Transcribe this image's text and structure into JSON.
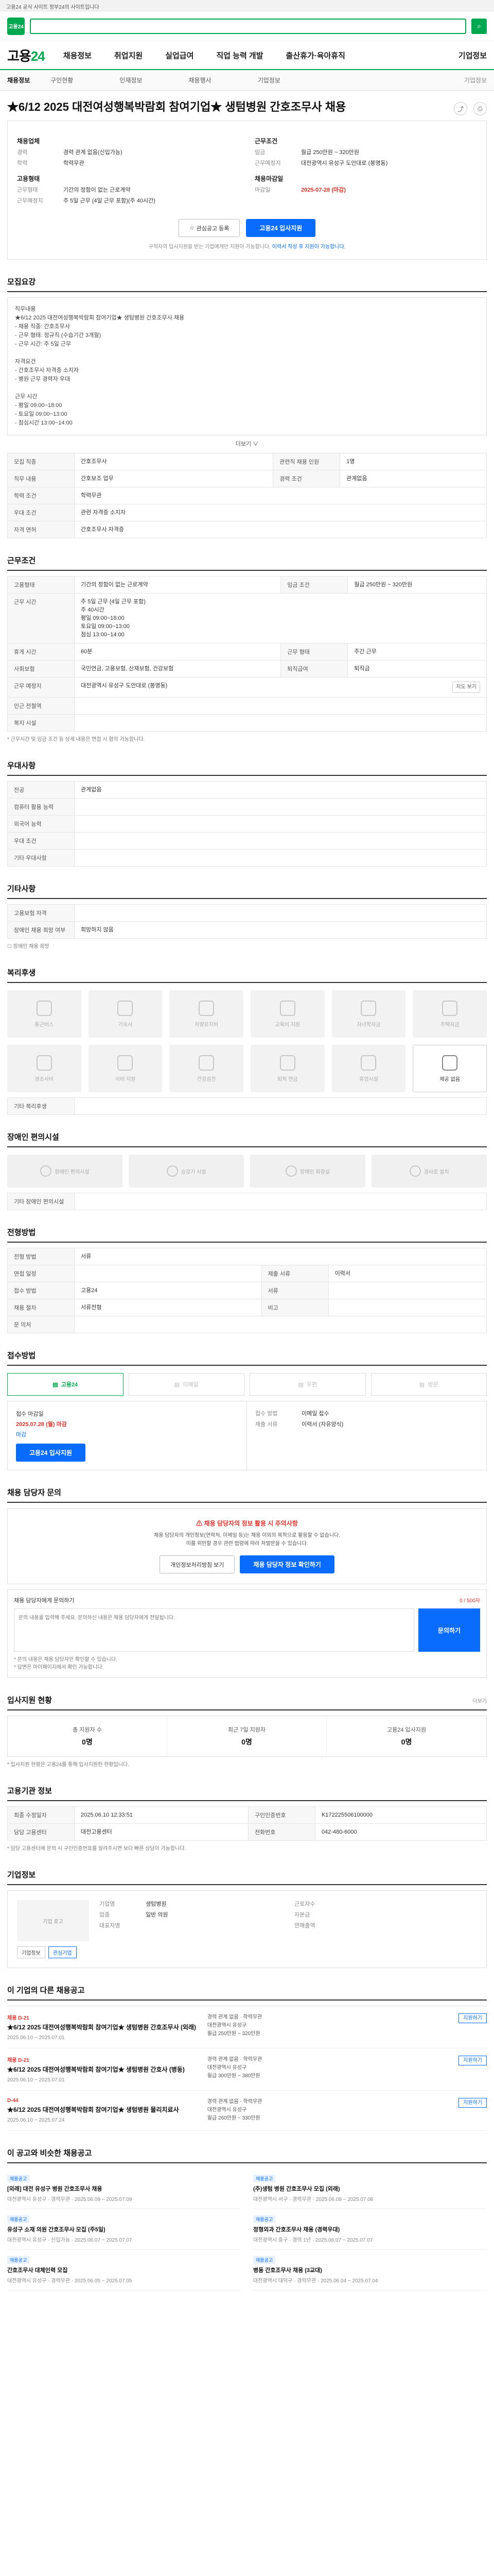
{
  "top_note": "고용24 공식 사이트 정부24의 사이트입니다",
  "search": {
    "logo_label": "고용24",
    "placeholder": "",
    "value": ""
  },
  "gnb": {
    "brand_a": "고용",
    "brand_b": "24",
    "items": [
      "채용정보",
      "취업지원",
      "실업급여",
      "직업 능력 개발",
      "출산휴가·육아휴직"
    ],
    "right": "기업정보"
  },
  "subnav": {
    "items": [
      "채용정보",
      "구인현황",
      "인재정보",
      "채용행사",
      "기업정보",
      "기업정보"
    ]
  },
  "job_title": "★6/12 2025 대전여성행복박람회 참여기업★ 생텀병원 간호조무사 채용",
  "summary": {
    "left": [
      {
        "k": "채용업체",
        "v": ""
      },
      {
        "k": "경력",
        "v": "경력 관계 없음(신입가능)"
      },
      {
        "k": "학력",
        "v": "학력무관"
      },
      {
        "k": "고용형태",
        "v": ""
      },
      {
        "k": "근무형태",
        "v": "기간의 정함이 없는 근로계약"
      },
      {
        "k": "근무예정지",
        "v": "주 5일 근무 (4일 근무 포함)(주 40시간)"
      }
    ],
    "right": [
      {
        "k": "근무조건",
        "v": ""
      },
      {
        "k": "임금",
        "v": "월급 250만원 ~ 320만원"
      },
      {
        "k": "근무예정지",
        "v": "대전광역시 유성구 도안대로 (봉명동)"
      },
      {
        "k": "채용마감일",
        "v": ""
      },
      {
        "k": "마감일",
        "v": "2025-07-28 (마감)"
      }
    ],
    "save_label": "관심공고 등록",
    "apply_label": "고용24 입사지원",
    "note_a": "구직자의 입사지원을 받는 기업에게만 지원이 가능합니다.",
    "note_b": "이력서 작성 후 지원이 가능합니다."
  },
  "duties": {
    "title": "모집요강",
    "body": "직무내용\n★6/12 2025 대전여성행복박람회 참여기업★ 생텀병원 간호조무사 채용\n- 채용 직종: 간호조무사\n- 근무 형태: 정규직 (수습기간 3개월)\n- 근무 시간: 주 5일 근무\n\n자격요건\n- 간호조무사 자격증 소지자\n- 병원 근무 경력자 우대\n\n근무 시간\n- 평일 09:00~18:00\n- 토요일 09:00~13:00\n- 점심시간 13:00~14:00",
    "more": "더보기 ∨"
  },
  "recruit_table": [
    {
      "k": "모집 직종",
      "v": "간호조무사",
      "k2": "관련직 채용 인원",
      "v2": "1명"
    },
    {
      "k": "직무 내용",
      "v": "간호보조 업무",
      "k2": "경력 조건",
      "v2": "관계없음"
    },
    {
      "k": "학력 조건",
      "v": "학력무관",
      "k2": "",
      "v2": ""
    },
    {
      "k": "우대 조건",
      "v": "관련 자격증 소지자",
      "k2": "",
      "v2": ""
    },
    {
      "k": "자격 면허",
      "v": "간호조무사 자격증",
      "k2": "",
      "v2": ""
    }
  ],
  "conditions": {
    "title": "근무조건",
    "rows": [
      {
        "k": "고용형태",
        "v": "기간의 정함이 없는 근로계약",
        "k2": "임금 조건",
        "v2": "월급 250만원 ~ 320만원"
      },
      {
        "k": "근무 시간",
        "v": "주 5일 근무 (4일 근무 포함)\n주 40시간\n평일 09:00~18:00\n토요일 09:00~13:00\n점심 13:00~14:00",
        "k2": "",
        "v2": ""
      },
      {
        "k": "휴게 시간",
        "v": "60분",
        "k2": "근무 형태",
        "v2": "주간 근무"
      },
      {
        "k": "사회보험",
        "v": "국민연금, 고용보험, 산재보험, 건강보험",
        "k2": "퇴직급여",
        "v2": "퇴직금"
      },
      {
        "k": "근무 예정지",
        "v": "대전광역시 유성구 도안대로 (봉명동)",
        "k2": "",
        "v2": ""
      },
      {
        "k": "인근 전철역",
        "v": "",
        "k2": "",
        "v2": ""
      },
      {
        "k": "복지 시설",
        "v": "",
        "k2": "",
        "v2": ""
      }
    ],
    "map_btn": "지도 보기",
    "note": "* 근무시간 및 임금 조건 등 상세 내용은 면접 시 협의 가능합니다."
  },
  "qualify": {
    "title": "우대사항",
    "rows": [
      {
        "k": "전공",
        "v": "관계없음"
      },
      {
        "k": "컴퓨터 활용 능력",
        "v": ""
      },
      {
        "k": "외국어 능력",
        "v": ""
      },
      {
        "k": "우대 조건",
        "v": ""
      },
      {
        "k": "기타 우대사항",
        "v": ""
      }
    ]
  },
  "etc": {
    "title": "기타사항",
    "rows": [
      {
        "k": "고용보험 자격",
        "v": ""
      },
      {
        "k": "장애인 채용 희망 여부",
        "v": "희망하지 않음"
      }
    ],
    "note": "장애인 채용 희망"
  },
  "welfare": {
    "title": "복리후생",
    "items": [
      "통근버스",
      "기숙사",
      "차량유지비",
      "교육비 지원",
      "자녀학자금",
      "주택자금",
      "경조사비",
      "식비 지원",
      "건강검진",
      "퇴직 연금",
      "휴양시설",
      "제공 없음"
    ],
    "active_index": 11,
    "etc_label": "기타 복리후생"
  },
  "disability": {
    "title": "장애인 편의시설",
    "items": [
      "장애인 편의시설",
      "승강기 시설",
      "장애인 화장실",
      "경사로 설치"
    ],
    "note": "기타 장애인 편의시설"
  },
  "selection": {
    "title": "전형방법",
    "rows": [
      {
        "k": "전형 방법",
        "v": "서류",
        "k2": "",
        "v2": ""
      },
      {
        "k": "면접 일정",
        "v": "",
        "k2": "제출 서류",
        "v2": "이력서"
      },
      {
        "k": "접수 방법",
        "v": "고용24",
        "k2": "서류",
        "v2": ""
      },
      {
        "k": "채용 절차",
        "v": "서류전형",
        "k2": "비고",
        "v2": ""
      },
      {
        "k": "문 의처",
        "v": "",
        "k2": "",
        "v2": ""
      }
    ]
  },
  "apply_method": {
    "title": "접수방법",
    "items": [
      "고용24",
      "이메일",
      "우편",
      "방문"
    ],
    "active_index": 0
  },
  "deadline": {
    "left_label": "접수 마감일",
    "date": "2025.07.28 (월) 마감",
    "state": "마감",
    "apply_label": "고용24 입사지원",
    "right_label": "접수 방법",
    "right_value": "이메일 접수",
    "right_label2": "제출 서류",
    "right_value2": "이력서 (자유양식)"
  },
  "warning": {
    "section_title": "채용 담당자 문의",
    "title": "채용 담당자의 정보 활용 시 주의사항",
    "text": "채용 담당자의 개인정보(연락처, 이메일 등)는 채용 이외의 목적으로 활용할 수 없습니다.\n이를 위반할 경우 관련 법령에 따라 처벌받을 수 있습니다.",
    "btn_a": "개인정보처리방침 보기",
    "btn_b": "채용 담당자 정보 확인하기"
  },
  "qa": {
    "label": "채용 담당자에게 문의하기",
    "count": "0 / 500자",
    "placeholder": "문의 내용을 입력해 주세요. 문의하신 내용은 채용 담당자에게 전달됩니다.",
    "btn": "문의하기",
    "notes": "* 문의 내용은 채용 담당자만 확인할 수 있습니다.\n* 답변은 마이페이지에서 확인 가능합니다."
  },
  "status": {
    "title": "입사지원 현황",
    "more": "더보기",
    "cells": [
      {
        "label": "총 지원자 수",
        "n": "0명"
      },
      {
        "label": "최근 7일 지원자",
        "n": "0명"
      },
      {
        "label": "고용24 입사지원",
        "n": "0명"
      }
    ],
    "note": "* 입사지원 현황은 고용24를 통해 입사지원한 현황입니다."
  },
  "agency": {
    "title": "고용기관 정보",
    "rows": [
      {
        "k": "최종 수정일자",
        "v": "2025.06.10 12:33:51",
        "k2": "구인인증번호",
        "v2": "K172225506100000"
      },
      {
        "k": "담당 고용센터",
        "v": "대전고용센터",
        "k2": "전화번호",
        "v2": "042-480-6000"
      }
    ],
    "note": "* 담당 고용센터에 문의 시 구인인증번호를 알려주시면 보다 빠른 상담이 가능합니다."
  },
  "company": {
    "title": "기업정보",
    "logo_text": "기업 로고",
    "left": [
      {
        "k": "기업명",
        "v": "생텀병원"
      },
      {
        "k": "업종",
        "v": "일반 의원"
      },
      {
        "k": "대표자명",
        "v": ""
      }
    ],
    "right": [
      {
        "k": "근로자수",
        "v": ""
      },
      {
        "k": "자본금",
        "v": ""
      },
      {
        "k": "연매출액",
        "v": ""
      }
    ],
    "btn_a": "기업정보",
    "btn_b": "관심기업"
  },
  "other_jobs": {
    "title": "이 기업의 다른 채용공고",
    "rows": [
      {
        "badge": "채용 D-21",
        "title": "★6/12 2025 대전여성행복박람회 참여기업★ 생텀병원 간호조무사 (외래)",
        "date": "2025.06.10 ~ 2025.07.01",
        "meta": "경력 관계 없음 · 학력무관\n대전광역시 유성구\n월급 250만원 ~ 320만원",
        "btn": "지원하기"
      },
      {
        "badge": "채용 D-21",
        "title": "★6/12 2025 대전여성행복박람회 참여기업★ 생텀병원 간호사 (병동)",
        "date": "2025.06.10 ~ 2025.07.01",
        "meta": "경력 관계 없음 · 학력무관\n대전광역시 유성구\n월급 300만원 ~ 380만원",
        "btn": "지원하기"
      },
      {
        "badge": "D-44",
        "title": "★6/12 2025 대전여성행복박람회 참여기업★ 생텀병원 물리치료사",
        "date": "2025.06.10 ~ 2025.07.24",
        "meta": "경력 관계 없음 · 학력무관\n대전광역시 유성구\n월급 260만원 ~ 330만원",
        "btn": "지원하기"
      }
    ]
  },
  "recommend": {
    "title": "이 공고와 비슷한 채용공고",
    "cards": [
      {
        "tag": "채용공고",
        "title": "[외래] 대전 유성구 병원 간호조무사 채용",
        "meta": "대전광역시 유성구 · 경력무관 · 2025.06.09 ~ 2025.07.09"
      },
      {
        "tag": "채용공고",
        "title": "(주)생텀 병원 간호조무사 모집 (외래)",
        "meta": "대전광역시 서구 · 경력무관 · 2025.06.08 ~ 2025.07.08"
      },
      {
        "tag": "채용공고",
        "title": "유성구 소재 의원 간호조무사 모집 (주5일)",
        "meta": "대전광역시 유성구 · 신입가능 · 2025.06.07 ~ 2025.07.07"
      },
      {
        "tag": "채용공고",
        "title": "정형외과 간호조무사 채용 (경력우대)",
        "meta": "대전광역시 중구 · 경력 1년 · 2025.06.07 ~ 2025.07.07"
      },
      {
        "tag": "채용공고",
        "title": "간호조무사 대체인력 모집",
        "meta": "대전광역시 유성구 · 경력무관 · 2025.06.05 ~ 2025.07.05"
      },
      {
        "tag": "채용공고",
        "title": "병동 간호조무사 채용 (3교대)",
        "meta": "대전광역시 대덕구 · 경력무관 · 2025.06.04 ~ 2025.07.04"
      }
    ]
  }
}
